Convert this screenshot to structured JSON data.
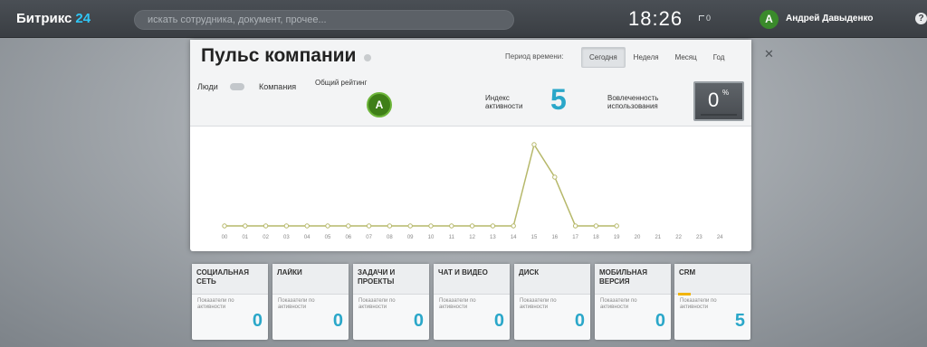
{
  "topbar": {
    "brand": "Битрикс",
    "brand_number": "24",
    "search_placeholder": "искать сотрудника, документ, прочее...",
    "time": "18:26",
    "flag_count": "0",
    "user_initial": "A",
    "user_name": "Андрей Давыденко",
    "user_chevron": "–",
    "help_label": "?"
  },
  "pulse": {
    "title": "Пульс компании",
    "period_label": "Период времени:",
    "tabs": [
      {
        "label": "Сегодня",
        "active": true
      },
      {
        "label": "Неделя",
        "active": false
      },
      {
        "label": "Месяц",
        "active": false
      },
      {
        "label": "Год",
        "active": false
      }
    ],
    "people_label": "Люди",
    "company_label": "Компания",
    "rating_label": "Общий рейтинг",
    "rating_value": "A",
    "index_label": "Индекс активности",
    "index_value": "5",
    "involvement_label": "Вовлеченность использования",
    "involvement_value": "0",
    "involvement_unit": "%"
  },
  "chart_data": {
    "type": "line",
    "categories": [
      "00",
      "01",
      "02",
      "03",
      "04",
      "05",
      "06",
      "07",
      "08",
      "09",
      "10",
      "11",
      "12",
      "13",
      "14",
      "15",
      "16",
      "17",
      "18",
      "19",
      "20",
      "21",
      "22",
      "23",
      "24"
    ],
    "series": [
      {
        "values": [
          0,
          0,
          0,
          0,
          0,
          0,
          0,
          0,
          0,
          0,
          0,
          0,
          0,
          0,
          0,
          5,
          3,
          0,
          0,
          0,
          null,
          null,
          null,
          null,
          null
        ]
      }
    ],
    "ylim": [
      0,
      5
    ],
    "grid": false,
    "color": "#b6b86a"
  },
  "cards": [
    {
      "title": "Социальная сеть",
      "subtitle": "Показатели по активности",
      "value": "0",
      "bar": false
    },
    {
      "title": "Лайки",
      "subtitle": "Показатели по активности",
      "value": "0",
      "bar": false
    },
    {
      "title": "Задачи и проекты",
      "subtitle": "Показатели по активности",
      "value": "0",
      "bar": false
    },
    {
      "title": "Чат и видео",
      "subtitle": "Показатели по активности",
      "value": "0",
      "bar": false
    },
    {
      "title": "Диск",
      "subtitle": "Показатели по активности",
      "value": "0",
      "bar": false
    },
    {
      "title": "Мобильная версия",
      "subtitle": "Показатели по активности",
      "value": "0",
      "bar": false
    },
    {
      "title": "CRM",
      "subtitle": "Показатели по активности",
      "value": "5",
      "bar": true
    }
  ]
}
